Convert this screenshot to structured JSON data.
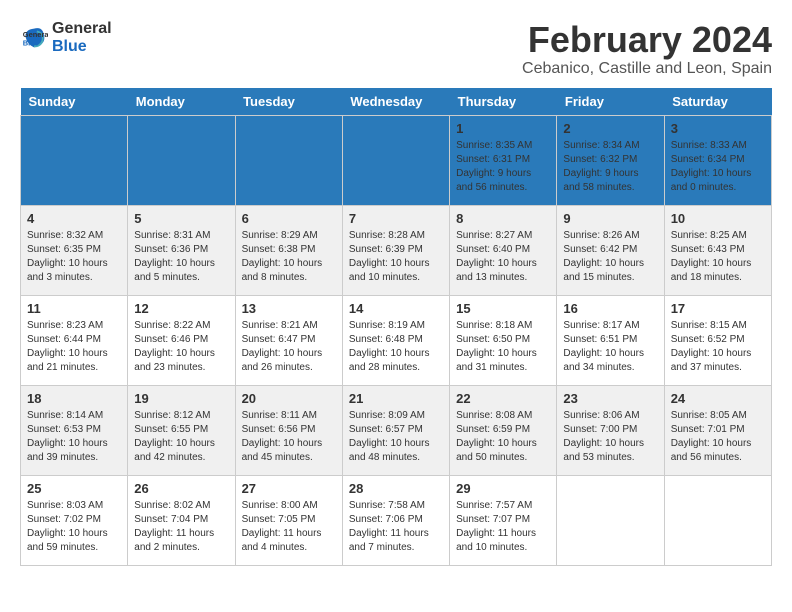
{
  "logo": {
    "line1": "General",
    "line2": "Blue"
  },
  "title": "February 2024",
  "location": "Cebanico, Castille and Leon, Spain",
  "headers": [
    "Sunday",
    "Monday",
    "Tuesday",
    "Wednesday",
    "Thursday",
    "Friday",
    "Saturday"
  ],
  "weeks": [
    [
      {
        "date": "",
        "info": ""
      },
      {
        "date": "",
        "info": ""
      },
      {
        "date": "",
        "info": ""
      },
      {
        "date": "",
        "info": ""
      },
      {
        "date": "1",
        "info": "Sunrise: 8:35 AM\nSunset: 6:31 PM\nDaylight: 9 hours and 56 minutes."
      },
      {
        "date": "2",
        "info": "Sunrise: 8:34 AM\nSunset: 6:32 PM\nDaylight: 9 hours and 58 minutes."
      },
      {
        "date": "3",
        "info": "Sunrise: 8:33 AM\nSunset: 6:34 PM\nDaylight: 10 hours and 0 minutes."
      }
    ],
    [
      {
        "date": "4",
        "info": "Sunrise: 8:32 AM\nSunset: 6:35 PM\nDaylight: 10 hours and 3 minutes."
      },
      {
        "date": "5",
        "info": "Sunrise: 8:31 AM\nSunset: 6:36 PM\nDaylight: 10 hours and 5 minutes."
      },
      {
        "date": "6",
        "info": "Sunrise: 8:29 AM\nSunset: 6:38 PM\nDaylight: 10 hours and 8 minutes."
      },
      {
        "date": "7",
        "info": "Sunrise: 8:28 AM\nSunset: 6:39 PM\nDaylight: 10 hours and 10 minutes."
      },
      {
        "date": "8",
        "info": "Sunrise: 8:27 AM\nSunset: 6:40 PM\nDaylight: 10 hours and 13 minutes."
      },
      {
        "date": "9",
        "info": "Sunrise: 8:26 AM\nSunset: 6:42 PM\nDaylight: 10 hours and 15 minutes."
      },
      {
        "date": "10",
        "info": "Sunrise: 8:25 AM\nSunset: 6:43 PM\nDaylight: 10 hours and 18 minutes."
      }
    ],
    [
      {
        "date": "11",
        "info": "Sunrise: 8:23 AM\nSunset: 6:44 PM\nDaylight: 10 hours and 21 minutes."
      },
      {
        "date": "12",
        "info": "Sunrise: 8:22 AM\nSunset: 6:46 PM\nDaylight: 10 hours and 23 minutes."
      },
      {
        "date": "13",
        "info": "Sunrise: 8:21 AM\nSunset: 6:47 PM\nDaylight: 10 hours and 26 minutes."
      },
      {
        "date": "14",
        "info": "Sunrise: 8:19 AM\nSunset: 6:48 PM\nDaylight: 10 hours and 28 minutes."
      },
      {
        "date": "15",
        "info": "Sunrise: 8:18 AM\nSunset: 6:50 PM\nDaylight: 10 hours and 31 minutes."
      },
      {
        "date": "16",
        "info": "Sunrise: 8:17 AM\nSunset: 6:51 PM\nDaylight: 10 hours and 34 minutes."
      },
      {
        "date": "17",
        "info": "Sunrise: 8:15 AM\nSunset: 6:52 PM\nDaylight: 10 hours and 37 minutes."
      }
    ],
    [
      {
        "date": "18",
        "info": "Sunrise: 8:14 AM\nSunset: 6:53 PM\nDaylight: 10 hours and 39 minutes."
      },
      {
        "date": "19",
        "info": "Sunrise: 8:12 AM\nSunset: 6:55 PM\nDaylight: 10 hours and 42 minutes."
      },
      {
        "date": "20",
        "info": "Sunrise: 8:11 AM\nSunset: 6:56 PM\nDaylight: 10 hours and 45 minutes."
      },
      {
        "date": "21",
        "info": "Sunrise: 8:09 AM\nSunset: 6:57 PM\nDaylight: 10 hours and 48 minutes."
      },
      {
        "date": "22",
        "info": "Sunrise: 8:08 AM\nSunset: 6:59 PM\nDaylight: 10 hours and 50 minutes."
      },
      {
        "date": "23",
        "info": "Sunrise: 8:06 AM\nSunset: 7:00 PM\nDaylight: 10 hours and 53 minutes."
      },
      {
        "date": "24",
        "info": "Sunrise: 8:05 AM\nSunset: 7:01 PM\nDaylight: 10 hours and 56 minutes."
      }
    ],
    [
      {
        "date": "25",
        "info": "Sunrise: 8:03 AM\nSunset: 7:02 PM\nDaylight: 10 hours and 59 minutes."
      },
      {
        "date": "26",
        "info": "Sunrise: 8:02 AM\nSunset: 7:04 PM\nDaylight: 11 hours and 2 minutes."
      },
      {
        "date": "27",
        "info": "Sunrise: 8:00 AM\nSunset: 7:05 PM\nDaylight: 11 hours and 4 minutes."
      },
      {
        "date": "28",
        "info": "Sunrise: 7:58 AM\nSunset: 7:06 PM\nDaylight: 11 hours and 7 minutes."
      },
      {
        "date": "29",
        "info": "Sunrise: 7:57 AM\nSunset: 7:07 PM\nDaylight: 11 hours and 10 minutes."
      },
      {
        "date": "",
        "info": ""
      },
      {
        "date": "",
        "info": ""
      }
    ]
  ]
}
